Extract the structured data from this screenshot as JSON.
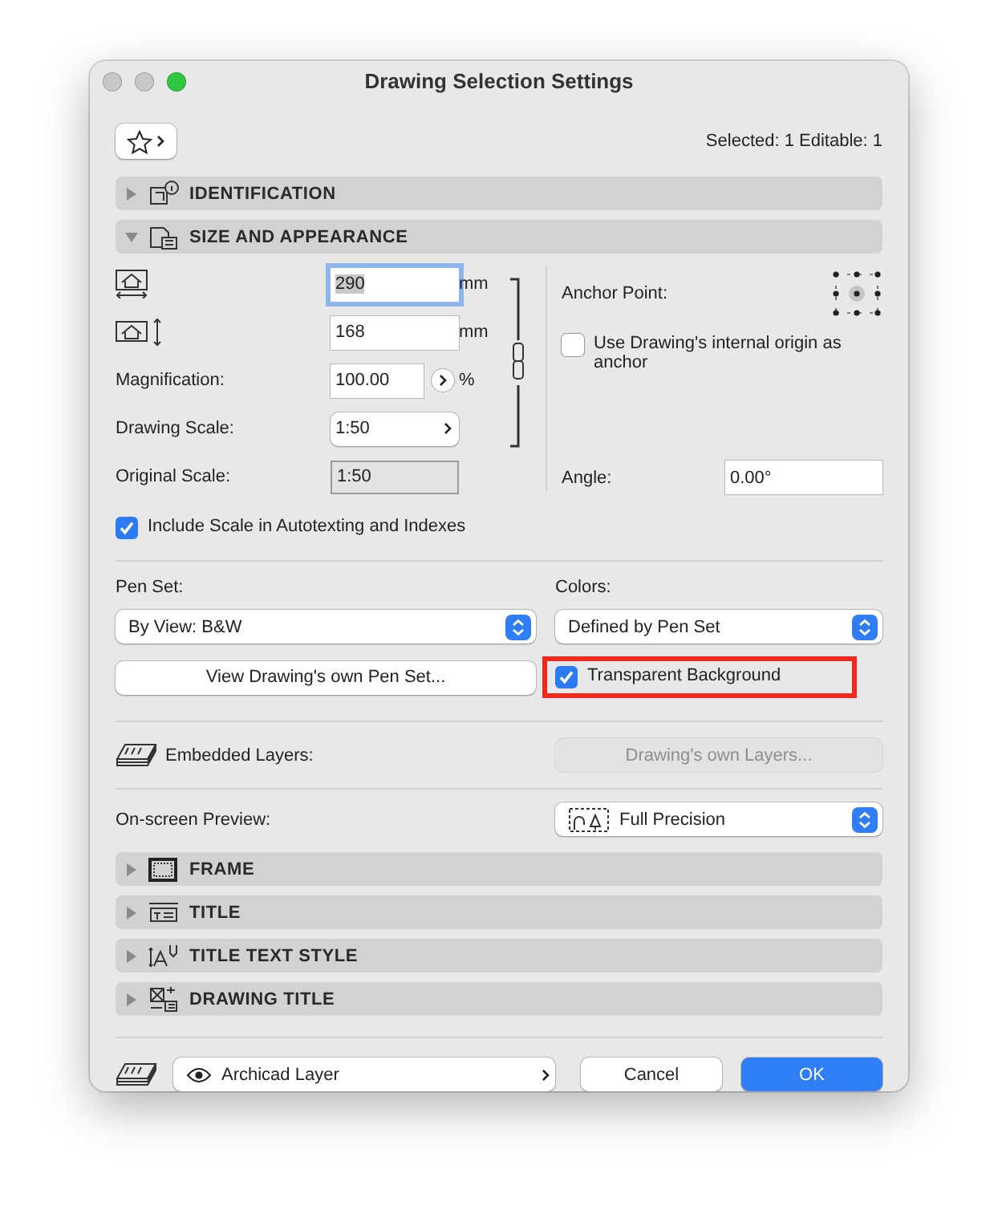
{
  "window": {
    "title": "Drawing Selection Settings"
  },
  "selection_info": "Selected: 1 Editable: 1",
  "sections": [
    {
      "kind": "identification",
      "label": "IDENTIFICATION",
      "expanded": false
    },
    {
      "kind": "size_and_appearance",
      "label": "SIZE AND APPEARANCE",
      "expanded": true
    },
    {
      "kind": "frame",
      "label": "FRAME",
      "expanded": false
    },
    {
      "kind": "title",
      "label": "TITLE",
      "expanded": false
    },
    {
      "kind": "title_text_style",
      "label": "TITLE TEXT STYLE",
      "expanded": false
    },
    {
      "kind": "drawing_title",
      "label": "DRAWING TITLE",
      "expanded": false
    }
  ],
  "size": {
    "width": {
      "value": "290",
      "unit": "mm",
      "focused": true
    },
    "height": {
      "value": "168",
      "unit": "mm",
      "focused": false
    },
    "magnification": {
      "label": "Magnification:",
      "value": "100.00",
      "unit": "%"
    },
    "drawing_scale": {
      "label": "Drawing Scale:",
      "value": "1:50"
    },
    "original_scale": {
      "label": "Original Scale:",
      "value": "1:50"
    },
    "anchor_point": {
      "label": "Anchor Point:"
    },
    "internal_origin": {
      "label": "Use Drawing's internal origin as anchor",
      "checked": false
    },
    "angle": {
      "label": "Angle:",
      "value": "0.00°"
    },
    "include_scale": {
      "label": "Include Scale in Autotexting and Indexes",
      "checked": true
    },
    "pen_set": {
      "label": "Pen Set:",
      "value": "By View: B&W"
    },
    "colors": {
      "label": "Colors:",
      "value": "Defined by Pen Set"
    },
    "view_pen_set_button": {
      "label": "View Drawing's own Pen Set..."
    },
    "transparent_background": {
      "label": "Transparent Background",
      "checked": true,
      "highlighted": true
    },
    "embedded_layers": {
      "label": "Embedded Layers:",
      "button": "Drawing's own Layers...",
      "disabled": true
    },
    "preview": {
      "label": "On-screen Preview:",
      "value": "Full Precision"
    }
  },
  "footer": {
    "layer": "Archicad Layer",
    "buttons": [
      {
        "label": "Cancel",
        "kind": "secondary"
      },
      {
        "label": "OK",
        "kind": "primary"
      }
    ]
  }
}
